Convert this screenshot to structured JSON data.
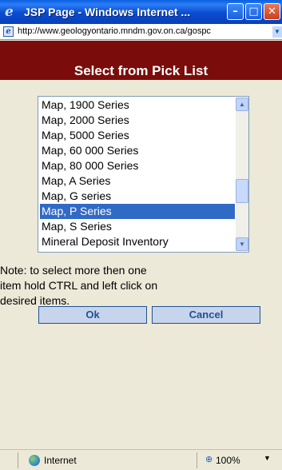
{
  "window": {
    "title": "JSP Page - Windows Internet ...",
    "minimize_glyph": "–",
    "maximize_glyph": "□",
    "close_glyph": "✕"
  },
  "address": {
    "url": "http://www.geologyontario.mndm.gov.on.ca/gospc"
  },
  "page": {
    "header": "Select from Pick List",
    "list_items": [
      "Map, 1900 Series",
      "Map, 2000 Series",
      "Map, 5000 Series",
      "Map, 60 000 Series",
      "Map, 80 000 Series",
      "Map, A Series",
      "Map, G series",
      "Map, P Series",
      "Map, S Series",
      "Mineral Deposit Inventory"
    ],
    "selected_item": "Map, P Series",
    "note_lines": [
      "Note: to select more then one",
      "item hold CTRL and left click on",
      "desired items."
    ],
    "ok_label": "Ok",
    "cancel_label": "Cancel"
  },
  "status": {
    "zone": "Internet",
    "zoom": "100%"
  },
  "colors": {
    "header_red": "#8a0e0c",
    "selection_blue": "#316ac5",
    "button_text": "#215190"
  },
  "icons": {
    "browser": "ie-logo-icon",
    "page": "page-icon",
    "zone": "internet-globe-icon",
    "zoom": "zoom-icon"
  }
}
